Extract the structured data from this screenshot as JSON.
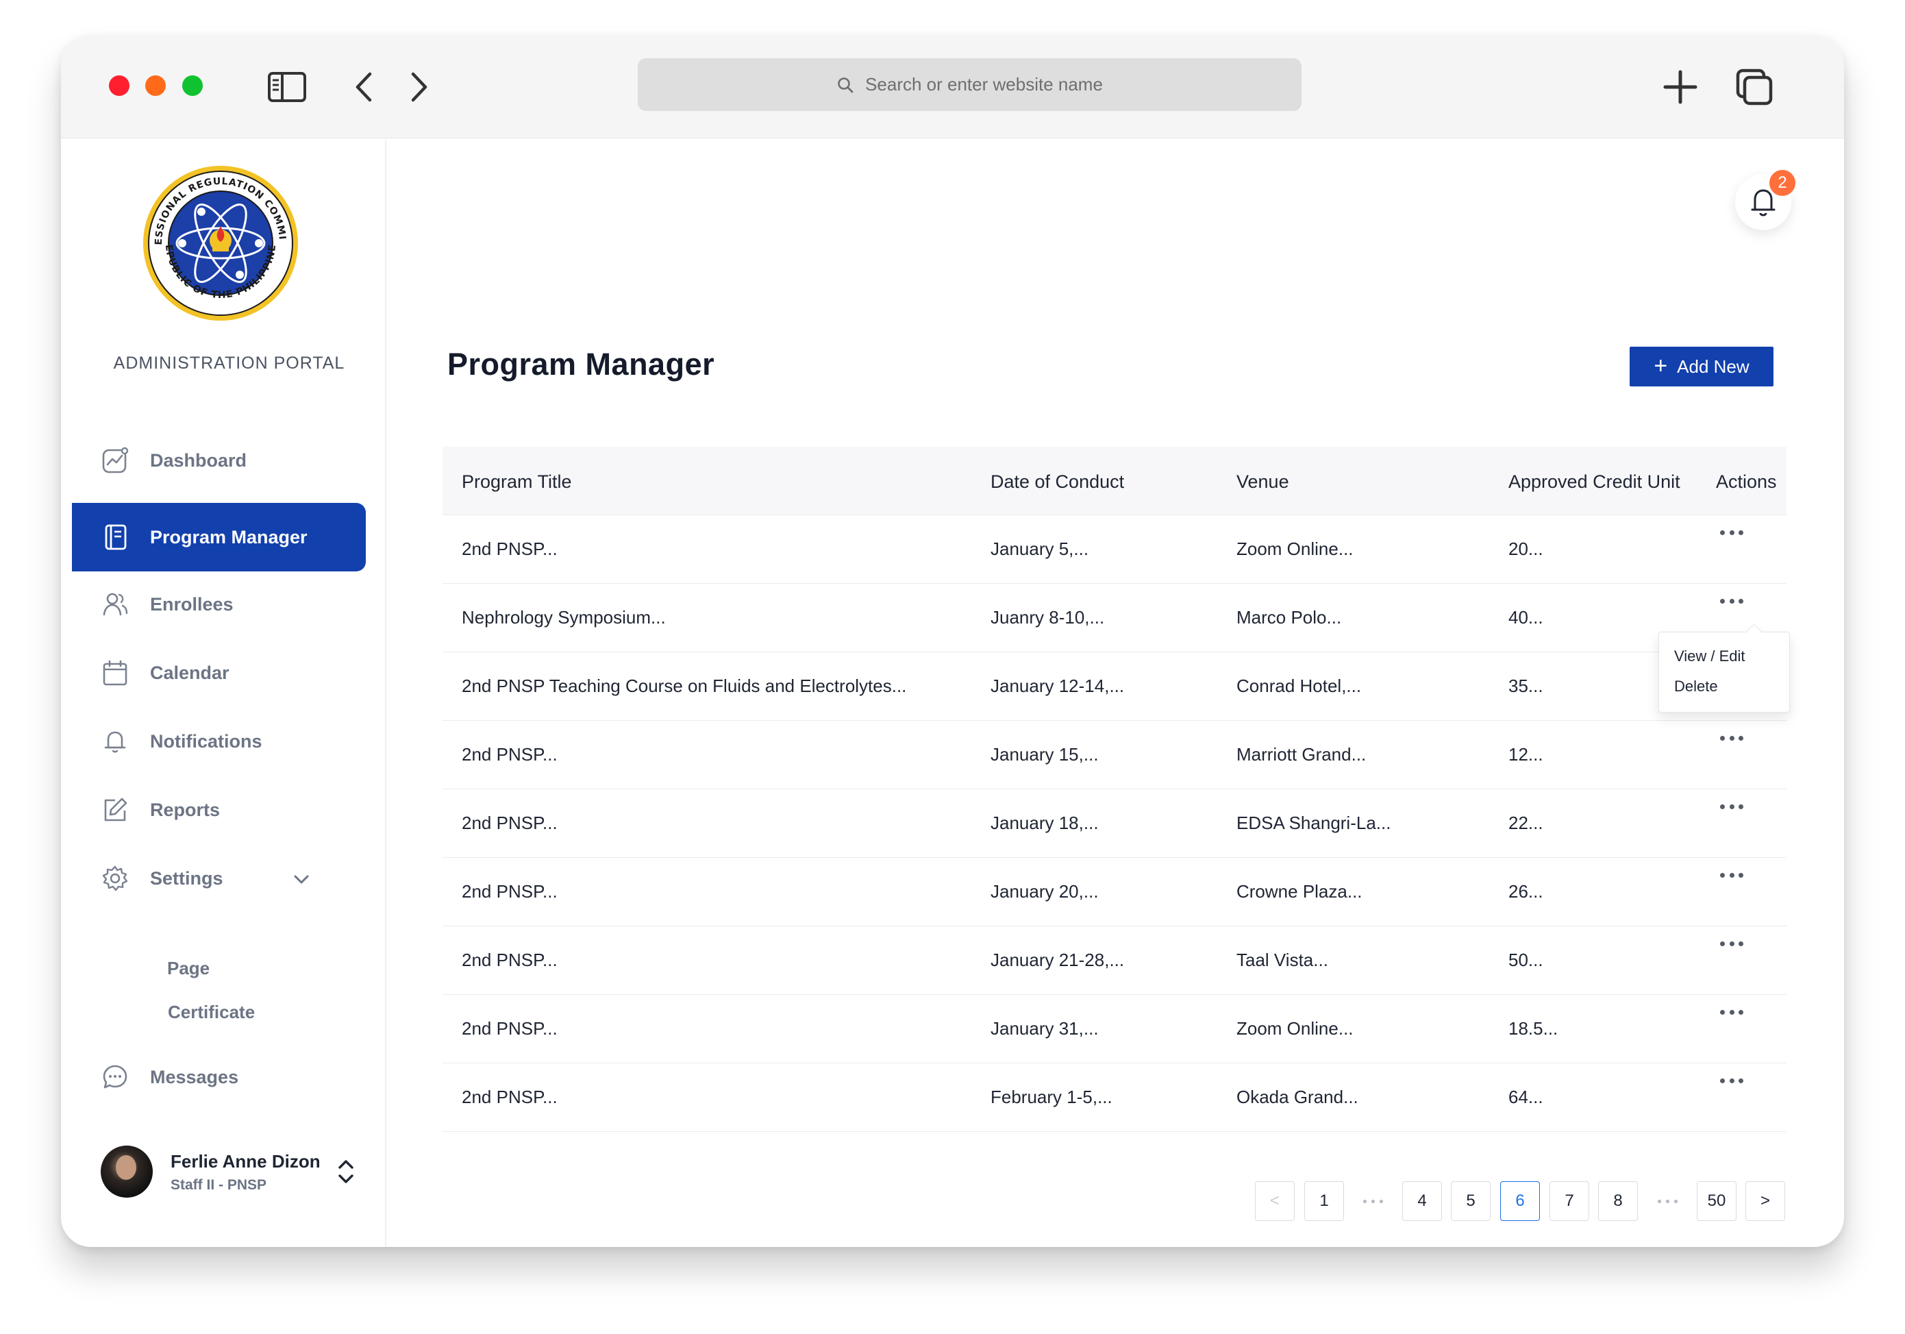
{
  "browser": {
    "search_placeholder": "Search or enter website name"
  },
  "sidebar": {
    "portal_title": "ADMINISTRATION PORTAL",
    "items": [
      {
        "label": "Dashboard",
        "icon": "dashboard-chart-icon"
      },
      {
        "label": "Program Manager",
        "icon": "notebook-icon",
        "active": true
      },
      {
        "label": "Enrollees",
        "icon": "user-group-icon"
      },
      {
        "label": "Calendar",
        "icon": "calendar-icon"
      },
      {
        "label": "Notifications",
        "icon": "bell-icon"
      },
      {
        "label": "Reports",
        "icon": "edit-report-icon"
      },
      {
        "label": "Settings",
        "icon": "gear-icon",
        "expanded": true
      },
      {
        "label": "Messages",
        "icon": "chat-bubble-icon"
      }
    ],
    "settings_sub": [
      "Page",
      "Certificate"
    ],
    "user": {
      "name": "Ferlie Anne Dizon",
      "role": "Staff II - PNSP"
    }
  },
  "header": {
    "notification_count": "2"
  },
  "main": {
    "title": "Program Manager",
    "add_button": "Add New",
    "columns": [
      "Program Title",
      "Date of Conduct",
      "Venue",
      "Approved Credit Unit",
      "Actions"
    ],
    "rows": [
      {
        "title": "2nd PNSP...",
        "date": "January 5,...",
        "venue": "Zoom Online...",
        "credit": "20..."
      },
      {
        "title": "Nephrology Symposium...",
        "date": "Juanry 8-10,...",
        "venue": "Marco Polo...",
        "credit": "40..."
      },
      {
        "title": "2nd PNSP Teaching Course on Fluids and Electrolytes...",
        "date": "January 12-14,...",
        "venue": "Conrad Hotel,...",
        "credit": "35..."
      },
      {
        "title": "2nd PNSP...",
        "date": "January 15,...",
        "venue": "Marriott Grand...",
        "credit": "12..."
      },
      {
        "title": "2nd PNSP...",
        "date": "January 18,...",
        "venue": "EDSA Shangri-La...",
        "credit": "22..."
      },
      {
        "title": "2nd PNSP...",
        "date": "January 20,...",
        "venue": "Crowne Plaza...",
        "credit": "26..."
      },
      {
        "title": "2nd PNSP...",
        "date": "January 21-28,...",
        "venue": "Taal Vista...",
        "credit": "50..."
      },
      {
        "title": "2nd PNSP...",
        "date": "January 31,...",
        "venue": "Zoom Online...",
        "credit": "18.5..."
      },
      {
        "title": "2nd PNSP...",
        "date": "February 1-5,...",
        "venue": "Okada Grand...",
        "credit": "64..."
      }
    ],
    "action_menu": [
      "View / Edit",
      "Delete"
    ],
    "pagination": {
      "prev": "<",
      "next": ">",
      "pages": [
        "1",
        "4",
        "5",
        "6",
        "7",
        "8",
        "50"
      ],
      "current": "6"
    }
  },
  "colors": {
    "primary": "#1240ad",
    "badge": "#ff6f3c",
    "active_page": "#1a73e8"
  }
}
